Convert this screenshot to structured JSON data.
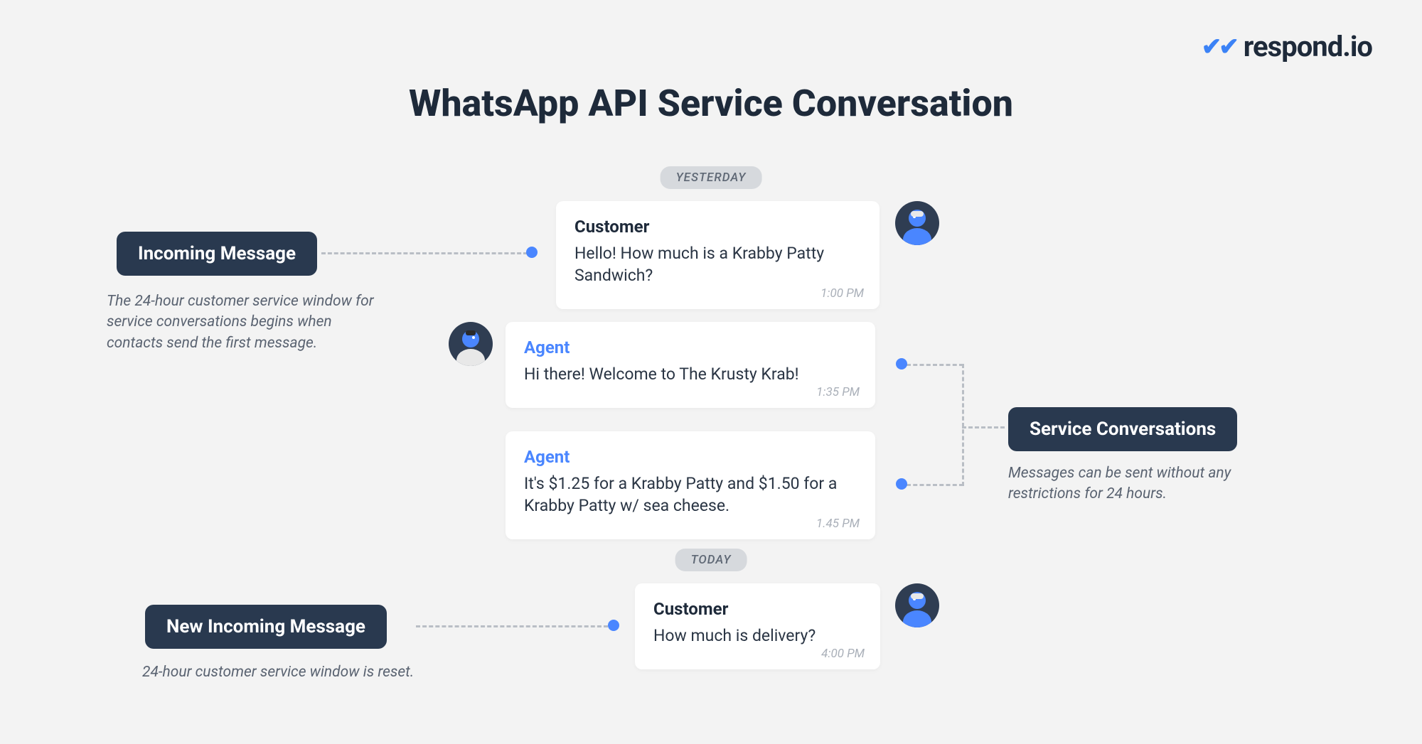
{
  "brand": {
    "name": "respond.io"
  },
  "title": "WhatsApp API Service Conversation",
  "separators": {
    "yesterday": "YESTERDAY",
    "today": "TODAY"
  },
  "messages": {
    "m1": {
      "sender": "Customer",
      "body": "Hello! How much is a Krabby Patty Sandwich?",
      "time": "1:00 PM"
    },
    "m2": {
      "sender": "Agent",
      "body": "Hi there! Welcome to The Krusty Krab!",
      "time": "1:35 PM"
    },
    "m3": {
      "sender": "Agent",
      "body": "It's $1.25 for a Krabby Patty and $1.50 for a Krabby Patty w/ sea cheese.",
      "time": "1.45 PM"
    },
    "m4": {
      "sender": "Customer",
      "body": "How much is delivery?",
      "time": "4:00 PM"
    }
  },
  "annotations": {
    "incoming": {
      "label": "Incoming Message",
      "caption": "The 24-hour customer service window for service conversations begins when contacts send the first message."
    },
    "service": {
      "label": "Service Conversations",
      "caption": "Messages can be sent without any restrictions for 24 hours."
    },
    "new_incoming": {
      "label": "New Incoming Message",
      "caption": "24-hour customer service window is reset."
    }
  }
}
